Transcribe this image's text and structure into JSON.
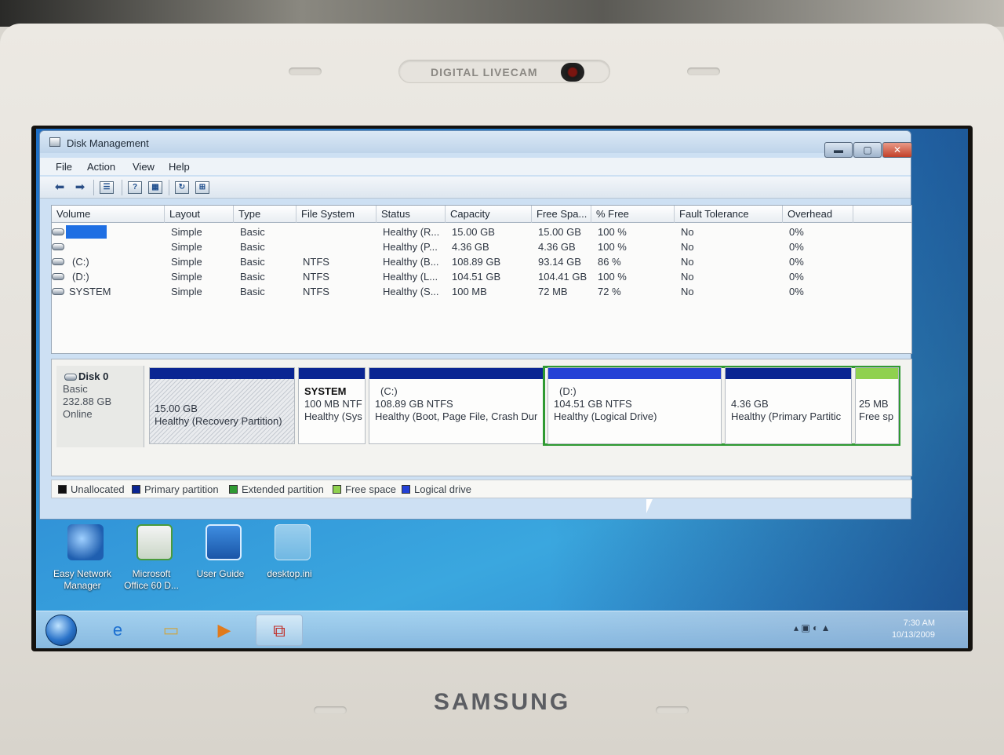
{
  "bezel": {
    "camera_label": "DIGITAL LIVECAM",
    "brand": "SAMSUNG"
  },
  "window": {
    "title": "Disk Management",
    "controls": {
      "minimize": "▬",
      "maximize": "▢",
      "close": "✕"
    }
  },
  "menu": [
    "File",
    "Action",
    "View",
    "Help"
  ],
  "toolbar": {
    "icons": [
      "back-arrow-icon",
      "forward-arrow-icon",
      "console-tree-icon",
      "help-icon",
      "properties-icon",
      "refresh-icon",
      "rescan-icon"
    ]
  },
  "volume_list": {
    "columns": [
      "Volume",
      "Layout",
      "Type",
      "File System",
      "Status",
      "Capacity",
      "Free Spa...",
      "% Free",
      "Fault Tolerance",
      "Overhead"
    ],
    "rows": [
      {
        "volume": "",
        "layout": "Simple",
        "type": "Basic",
        "fs": "",
        "status": "Healthy (R...",
        "capacity": "15.00 GB",
        "free": "15.00 GB",
        "pct": "100 %",
        "fault": "No",
        "overhead": "0%"
      },
      {
        "volume": "",
        "layout": "Simple",
        "type": "Basic",
        "fs": "",
        "status": "Healthy (P...",
        "capacity": "4.36 GB",
        "free": "4.36 GB",
        "pct": "100 %",
        "fault": "No",
        "overhead": "0%"
      },
      {
        "volume": "(C:)",
        "layout": "Simple",
        "type": "Basic",
        "fs": "NTFS",
        "status": "Healthy (B...",
        "capacity": "108.89 GB",
        "free": "93.14 GB",
        "pct": "86 %",
        "fault": "No",
        "overhead": "0%"
      },
      {
        "volume": "(D:)",
        "layout": "Simple",
        "type": "Basic",
        "fs": "NTFS",
        "status": "Healthy (L...",
        "capacity": "104.51 GB",
        "free": "104.41 GB",
        "pct": "100 %",
        "fault": "No",
        "overhead": "0%"
      },
      {
        "volume": "SYSTEM",
        "layout": "Simple",
        "type": "Basic",
        "fs": "NTFS",
        "status": "Healthy (S...",
        "capacity": "100 MB",
        "free": "72 MB",
        "pct": "72 %",
        "fault": "No",
        "overhead": "0%"
      }
    ]
  },
  "disk": {
    "name": "Disk 0",
    "type": "Basic",
    "size": "232.88 GB",
    "state": "Online",
    "partitions": [
      {
        "line1": "",
        "line2": "15.00 GB",
        "line3": "Healthy (Recovery Partition)"
      },
      {
        "line1": "SYSTEM",
        "line2": "100 MB NTF",
        "line3": "Healthy (Sys"
      },
      {
        "line1": "(C:)",
        "line2": "108.89 GB NTFS",
        "line3": "Healthy (Boot, Page File, Crash Dur"
      },
      {
        "line1": "(D:)",
        "line2": "104.51 GB NTFS",
        "line3": "Healthy (Logical Drive)"
      },
      {
        "line1": "",
        "line2": "4.36 GB",
        "line3": "Healthy (Primary Partitic"
      },
      {
        "line1": "",
        "line2": "25 MB",
        "line3": "Free sp"
      }
    ]
  },
  "legend": [
    {
      "label": "Unallocated",
      "color": "#111111"
    },
    {
      "label": "Primary partition",
      "color": "#0a2592"
    },
    {
      "label": "Extended partition",
      "color": "#2f9a32"
    },
    {
      "label": "Free space",
      "color": "#8fd14f"
    },
    {
      "label": "Logical drive",
      "color": "#2441d6"
    }
  ],
  "desktop_icons": [
    {
      "label1": "Easy Network",
      "label2": "Manager"
    },
    {
      "label1": "Microsoft",
      "label2": "Office 60 D..."
    },
    {
      "label1": "User Guide",
      "label2": ""
    },
    {
      "label1": "desktop.ini",
      "label2": ""
    }
  ],
  "taskbar": {
    "clock_time": "7:30 AM",
    "clock_date": "10/13/2009"
  },
  "colors": {
    "primary_partition": "#0a2592",
    "logical_drive": "#2441d6",
    "extended_partition": "#2f9a32",
    "free_space": "#8fd14f"
  }
}
